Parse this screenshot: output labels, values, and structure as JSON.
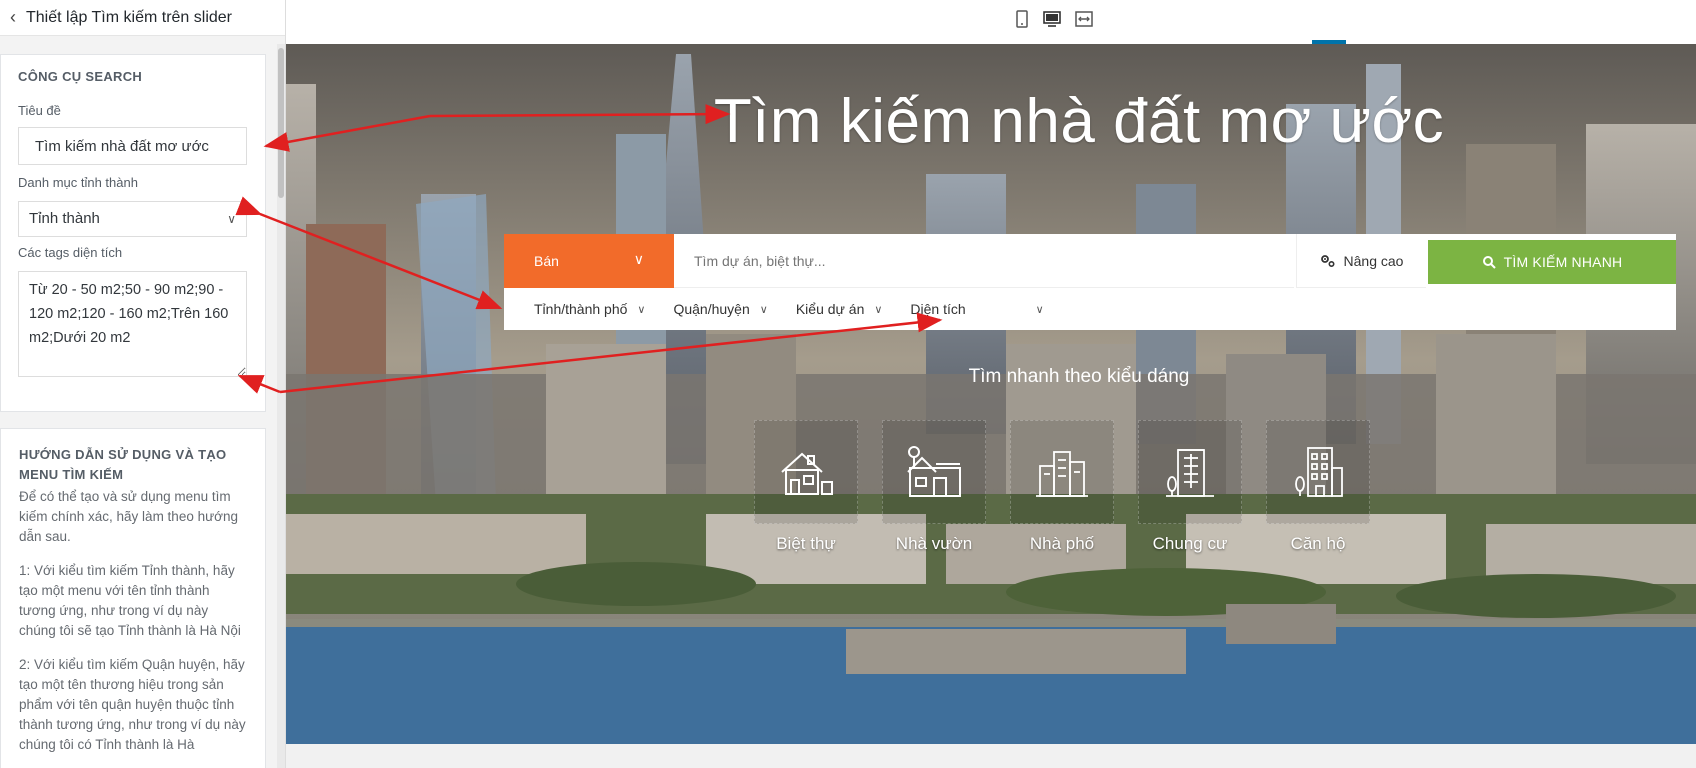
{
  "panel": {
    "title": "Thiết lập Tìm kiếm trên slider",
    "tool_section": {
      "heading": "CÔNG CỤ SEARCH",
      "title_label": "Tiêu đề",
      "title_value": "Tìm kiếm nhà đất mơ ước",
      "province_label": "Danh mục tỉnh thành",
      "province_value": "Tỉnh thành",
      "tags_label": "Các tags diện tích",
      "tags_value": "Từ 20 - 50 m2;50 - 90 m2;90 - 120 m2;120 - 160 m2;Trên 160 m2;Dưới 20 m2"
    },
    "guide_section": {
      "heading": "HƯỚNG DẪN SỬ DỤNG VÀ TẠO MENU TÌM KIẾM",
      "intro": "Để có thể tạo và sử dụng menu tìm kiếm chính xác, hãy làm theo hướng dẫn sau.",
      "step1": "1: Với kiểu tìm kiếm Tỉnh thành, hãy tạo một menu với tên tỉnh thành tương ứng, như trong ví dụ này chúng tôi sẽ tạo Tỉnh thành là Hà Nội",
      "step2": "2: Với kiểu tìm kiếm Quận huyện, hãy tạo một tên thương hiệu trong sản phẩm với tên quận huyện thuộc tỉnh thành tương ứng, như trong ví dụ này chúng tôi có Tỉnh thành là Hà"
    }
  },
  "device_bar": {
    "active": "desktop",
    "accent_color": "#0073aa"
  },
  "hero": {
    "title": "Tìm kiếm nhà đất mơ ước",
    "search": {
      "sale_label": "Bán",
      "keyword_placeholder": "Tìm dự án, biệt thự...",
      "advanced_label": "Nâng cao",
      "quick_search_label": "TÌM KIẾM NHANH",
      "filters": [
        "Tỉnh/thành phố",
        "Quận/huyện",
        "Kiểu dự án",
        "Diện tích"
      ]
    },
    "quick_heading": "Tìm nhanh theo kiểu dáng",
    "types": [
      {
        "label": "Biệt thự",
        "icon": "villa-icon"
      },
      {
        "label": "Nhà vườn",
        "icon": "garden-house-icon"
      },
      {
        "label": "Nhà phố",
        "icon": "townhouse-icon"
      },
      {
        "label": "Chung cư",
        "icon": "apartment-building-icon"
      },
      {
        "label": "Căn hộ",
        "icon": "condo-icon"
      }
    ],
    "colors": {
      "sale": "#f26b2a",
      "quick_search": "#7cb443",
      "annotation_arrow": "#e02020"
    }
  }
}
